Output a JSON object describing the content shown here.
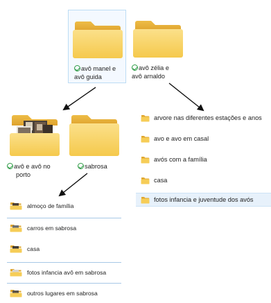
{
  "colors": {
    "folder_back": "#e8b23a",
    "folder_front": "#f8d568",
    "selection_fill": "#f4f9ff",
    "selection_border": "#bcdcf4",
    "sync_check": "#2e9b45",
    "arrow": "#111111"
  },
  "top_folders": [
    {
      "label_line1": "avô manel e",
      "label_line2": "avô guida",
      "status_icon": "check-circle-icon"
    },
    {
      "label_line1": "avô zélia e",
      "label_line2": "avô arnaldo",
      "status_icon": "check-circle-icon"
    }
  ],
  "mid_folders": [
    {
      "label_line1": "avô e avô no",
      "label_line2": "porto",
      "status_icon": "check-circle-icon"
    },
    {
      "label_line1": "sabrosa",
      "label_line2": "",
      "status_icon": "check-circle-icon"
    }
  ],
  "right_list": [
    {
      "label": "arvore nas diferentes estações e anos",
      "icon": "folder-icon"
    },
    {
      "label": "avo e avo em casal",
      "icon": "folder-icon"
    },
    {
      "label": "avós com a família",
      "icon": "folder-icon"
    },
    {
      "label": "casa",
      "icon": "folder-icon"
    },
    {
      "label": "fotos infancia e juventude dos avós",
      "icon": "folder-icon",
      "selected": true
    }
  ],
  "bottom_list": [
    {
      "label": "almoço de família",
      "icon": "photo-folder-icon"
    },
    {
      "label": "carros em sabrosa",
      "icon": "photo-folder-icon"
    },
    {
      "label": "casa",
      "icon": "photo-folder-icon"
    },
    {
      "label": "fotos infancia avô em sabrosa",
      "icon": "photo-folder-icon"
    },
    {
      "label": "outros lugares em sabrosa",
      "icon": "photo-folder-icon"
    }
  ]
}
